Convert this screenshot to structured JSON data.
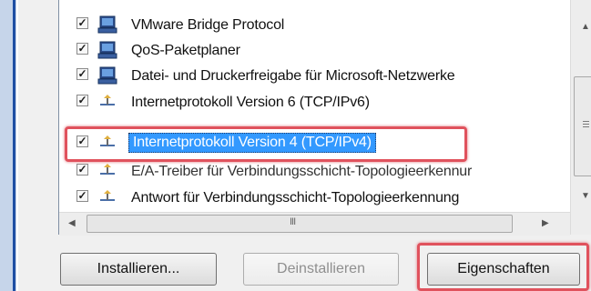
{
  "components": [
    {
      "label": "VMware Bridge Protocol",
      "checked": true,
      "icon": "network-client-icon"
    },
    {
      "label": "QoS-Paketplaner",
      "checked": true,
      "icon": "network-client-icon"
    },
    {
      "label": "Datei- und Druckerfreigabe für Microsoft-Netzwerke",
      "checked": true,
      "icon": "network-client-icon"
    },
    {
      "label": "Internetprotokoll Version 6 (TCP/IPv6)",
      "checked": true,
      "icon": "protocol-icon"
    },
    {
      "label": "Internetprotokoll Version 4 (TCP/IPv4)",
      "checked": true,
      "icon": "protocol-icon",
      "selected": true
    },
    {
      "label": "E/A-Treiber für Verbindungsschicht-Topologieerkennur",
      "checked": true,
      "icon": "protocol-icon"
    },
    {
      "label": "Antwort für Verbindungsschicht-Topologieerkennung",
      "checked": true,
      "icon": "protocol-icon"
    }
  ],
  "checkmark": "✓",
  "buttons": {
    "install": "Installieren...",
    "uninstall": "Deinstallieren",
    "properties": "Eigenschaften"
  },
  "scroll": {
    "up": "▲",
    "down": "▼",
    "left": "◀",
    "right": "▶",
    "grip": "III"
  },
  "colors": {
    "selection": "#3399ff",
    "highlight_border": "#e0525d"
  }
}
